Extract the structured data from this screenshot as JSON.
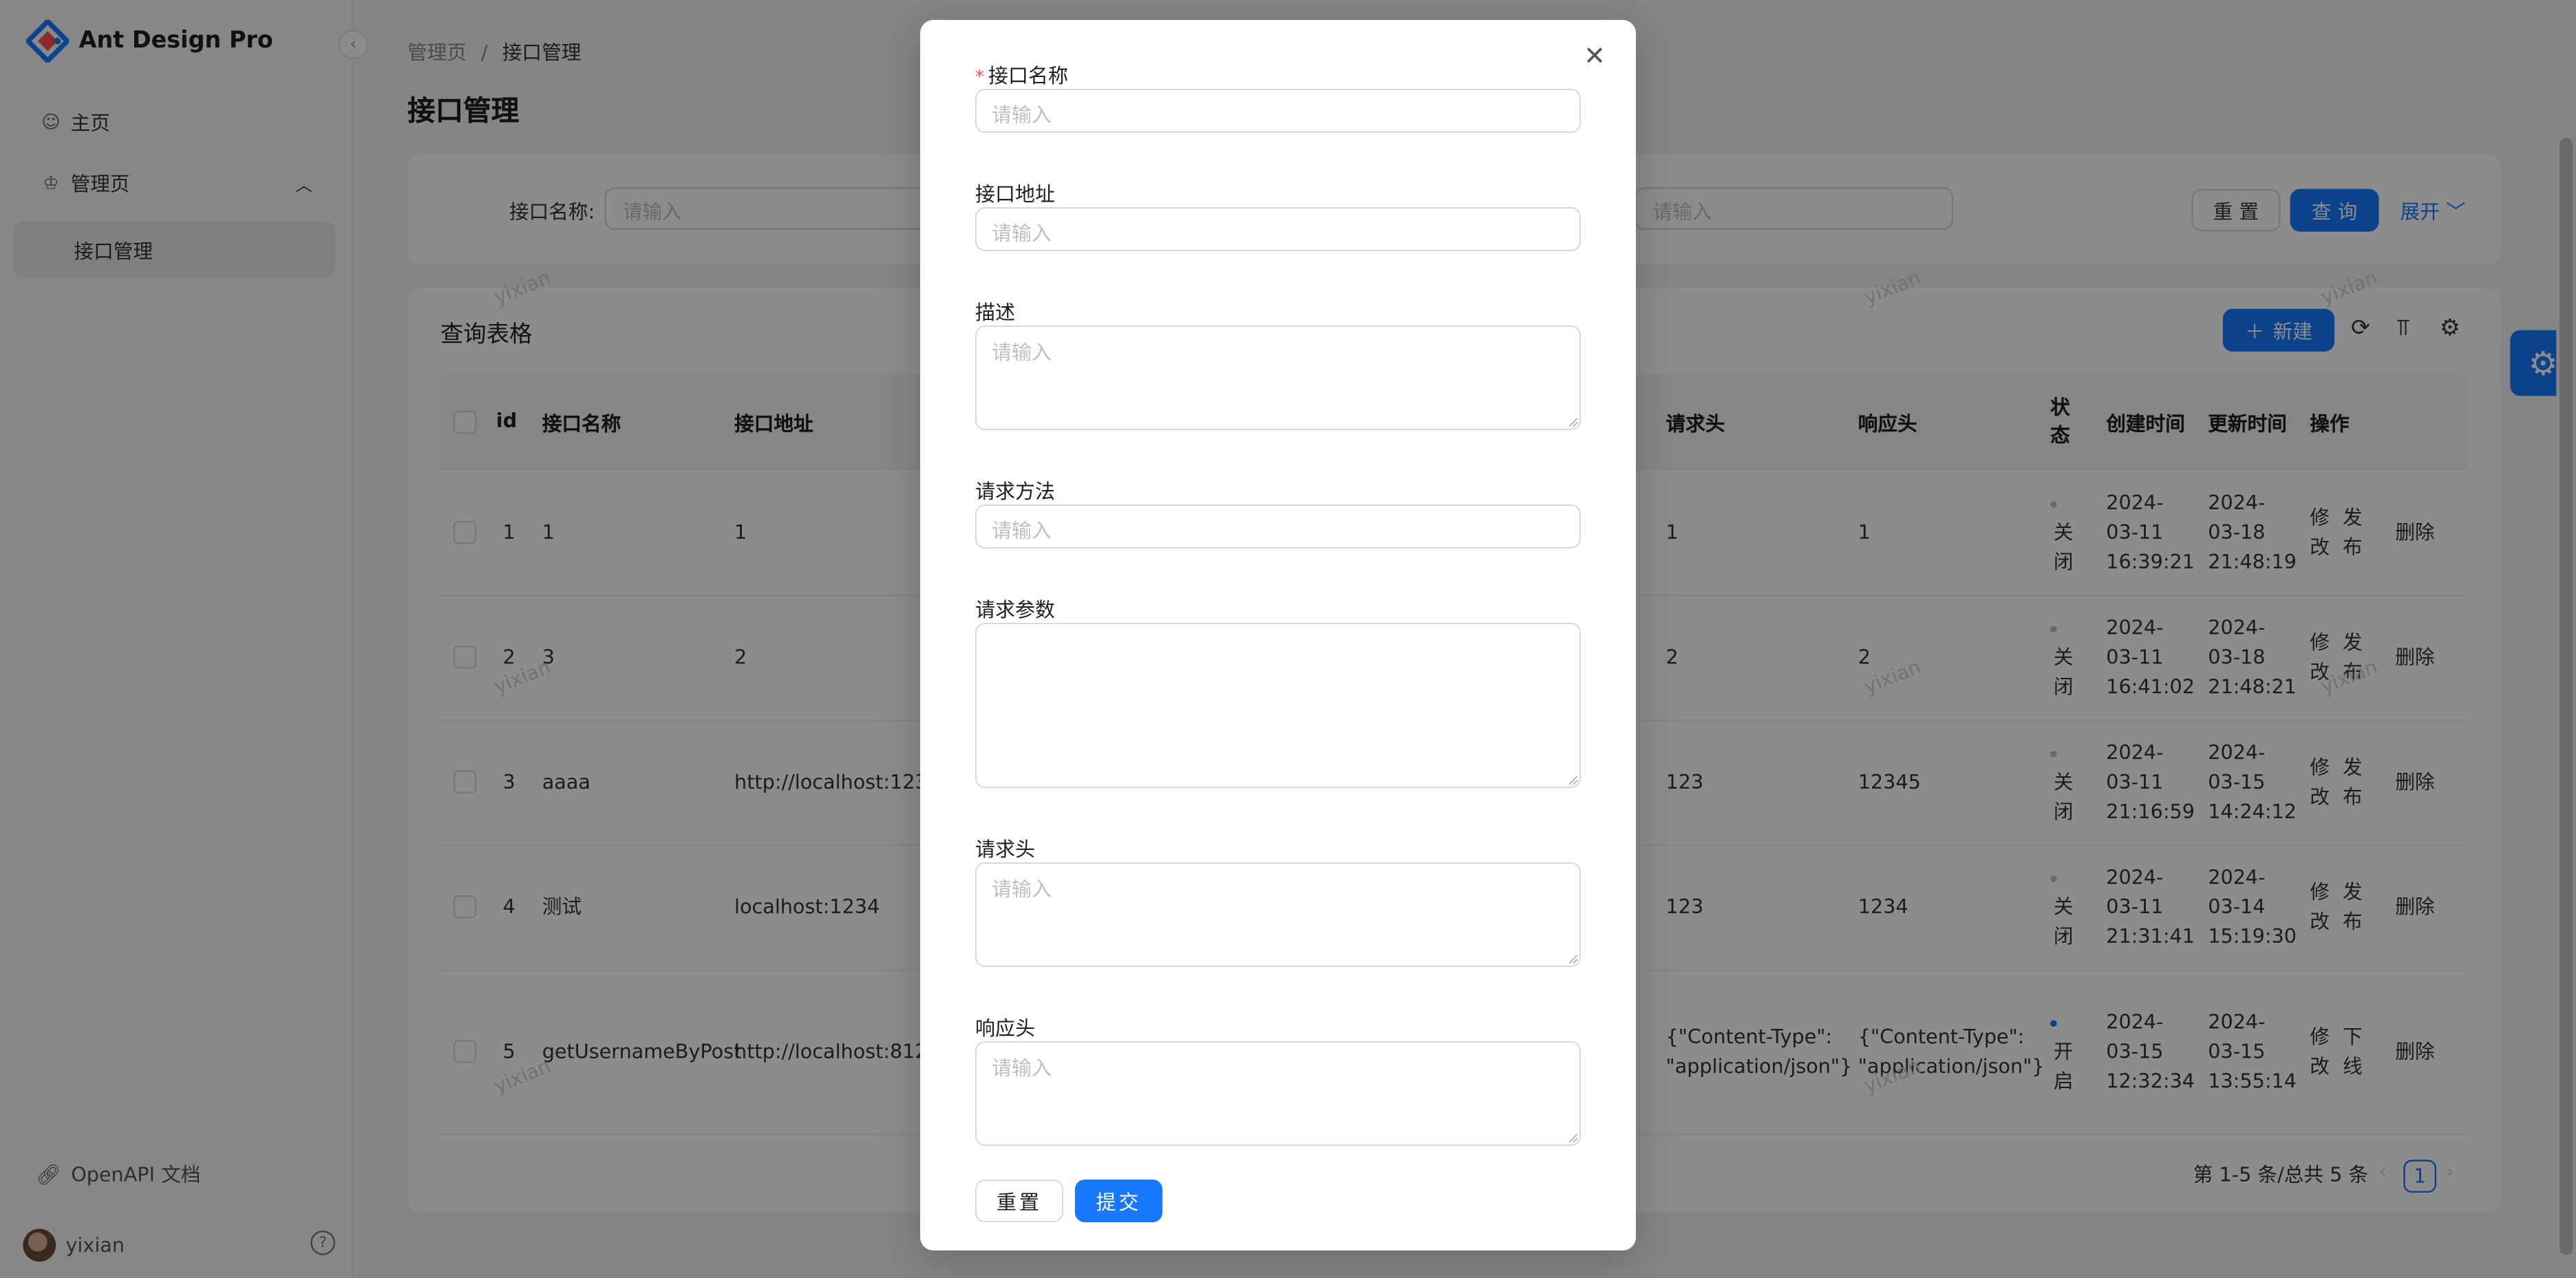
{
  "app": {
    "title": "Ant Design Pro"
  },
  "sidebar": {
    "items": [
      {
        "label": "主页"
      },
      {
        "label": "管理页"
      },
      {
        "label": "接口管理"
      }
    ],
    "openapi": "OpenAPI 文档",
    "user": "yixian"
  },
  "breadcrumb": {
    "parent": "管理页",
    "sep": "/",
    "current": "接口管理"
  },
  "page_title": "接口管理",
  "search": {
    "label": "接口名称:",
    "placeholder": "请输入",
    "placeholder2": "请输入",
    "reset": "重 置",
    "query": "查 询",
    "expand": "展开"
  },
  "table": {
    "title": "查询表格",
    "new_button": "新建",
    "columns": {
      "id": "id",
      "name": "接口名称",
      "url": "接口地址",
      "req_header": "请求头",
      "resp_header": "响应头",
      "status": "状态",
      "created": "创建时间",
      "updated": "更新时间",
      "actions": "操作"
    },
    "rows": [
      {
        "id": "1",
        "name": "1",
        "url": "1",
        "req_header": "1",
        "resp_header": "1",
        "status": "关闭",
        "status_on": false,
        "created": "2024-03-11 16:39:21",
        "updated": "2024-03-18 21:48:19",
        "action_edit": "修改",
        "action_toggle": "发布",
        "action_delete": "删除"
      },
      {
        "id": "2",
        "name": "3",
        "url": "2",
        "req_header": "2",
        "resp_header": "2",
        "status": "关闭",
        "status_on": false,
        "created": "2024-03-11 16:41:02",
        "updated": "2024-03-18 21:48:21",
        "action_edit": "修改",
        "action_toggle": "发布",
        "action_delete": "删除"
      },
      {
        "id": "3",
        "name": "aaaa",
        "url": "http://localhost:1234",
        "req_header": "123",
        "resp_header": "12345",
        "status": "关闭",
        "status_on": false,
        "created": "2024-03-11 21:16:59",
        "updated": "2024-03-15 14:24:12",
        "action_edit": "修改",
        "action_toggle": "发布",
        "action_delete": "删除"
      },
      {
        "id": "4",
        "name": "测试",
        "url": "localhost:1234",
        "req_header": "123",
        "resp_header": "1234",
        "status": "关闭",
        "status_on": false,
        "created": "2024-03-11 21:31:41",
        "updated": "2024-03-14 15:19:30",
        "action_edit": "修改",
        "action_toggle": "发布",
        "action_delete": "删除"
      },
      {
        "id": "5",
        "name": "getUsernameByPost",
        "url": "http://localhost:8123/...",
        "req_header": "{\"Content-Type\": \"application/json\"}",
        "resp_header": "{\"Content-Type\": \"application/json\"}",
        "status": "开启",
        "status_on": true,
        "created": "2024-03-15 12:32:34",
        "updated": "2024-03-15 13:55:14",
        "action_edit": "修改",
        "action_toggle": "下线",
        "action_delete": "删除"
      }
    ],
    "pagination": {
      "summary": "第 1-5 条/总共 5 条",
      "current": "1"
    }
  },
  "watermark": "yixian",
  "modal": {
    "fields": [
      {
        "label": "接口名称",
        "required": true,
        "placeholder": "请输入"
      },
      {
        "label": "接口地址",
        "required": false,
        "placeholder": "请输入"
      },
      {
        "label": "描述",
        "required": false,
        "placeholder": "请输入"
      },
      {
        "label": "请求方法",
        "required": false,
        "placeholder": "请输入"
      },
      {
        "label": "请求参数",
        "required": false,
        "placeholder": ""
      },
      {
        "label": "请求头",
        "required": false,
        "placeholder": "请输入"
      },
      {
        "label": "响应头",
        "required": false,
        "placeholder": "请输入"
      }
    ],
    "reset": "重置",
    "submit": "提交",
    "close_glyph": "✕"
  },
  "colors": {
    "primary": "#1677ff",
    "danger": "#ff4d4f",
    "mask": "rgba(0,0,0,0.45)"
  }
}
